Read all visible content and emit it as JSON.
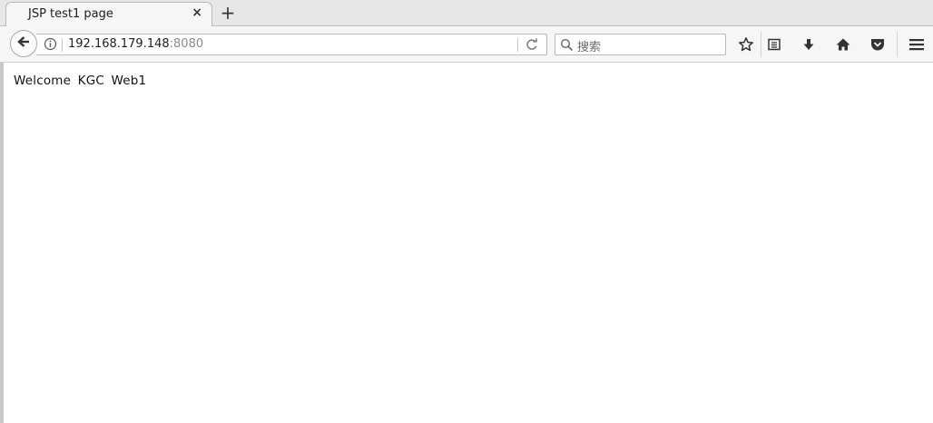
{
  "tab": {
    "title": "JSP test1 page",
    "close_glyph": "×"
  },
  "newtab": {
    "glyph": "+"
  },
  "url": {
    "host": "192.168.179.148",
    "port": ":8080"
  },
  "search": {
    "placeholder": "搜索"
  },
  "page": {
    "content": "Welcome KGC Web1"
  },
  "icons": [
    "back-arrow-icon",
    "info-icon",
    "reload-icon",
    "search-icon",
    "bookmark-star-icon",
    "reader-list-icon",
    "downloads-icon",
    "home-icon",
    "pocket-icon",
    "menu-icon"
  ]
}
